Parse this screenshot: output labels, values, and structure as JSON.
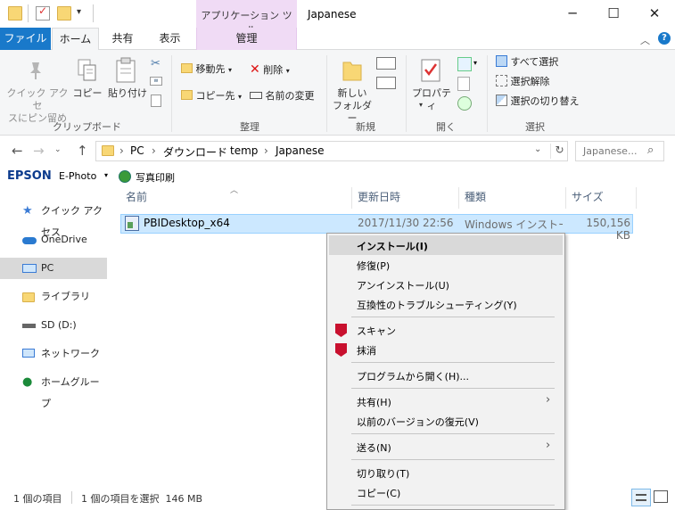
{
  "window": {
    "title": "Japanese",
    "context_tab_title": "アプリケーション ツール",
    "controls": {
      "minimize": "─",
      "maximize": "☐",
      "close": "✕"
    }
  },
  "tabs": [
    {
      "label": "ファイル"
    },
    {
      "label": "ホーム"
    },
    {
      "label": "共有"
    },
    {
      "label": "表示"
    },
    {
      "label": "管理"
    }
  ],
  "ribbon": {
    "clipboard": {
      "pin_label_1": "クイック アクセ",
      "pin_label_2": "スにピン留め",
      "copy_label": "コピー",
      "paste_label": "貼り付け",
      "group": "クリップボード"
    },
    "organize": {
      "move_to": "移動先",
      "copy_to": "コピー先",
      "delete": "削除",
      "rename": "名前の変更",
      "group": "整理"
    },
    "new": {
      "new_folder_1": "新しい",
      "new_folder_2": "フォルダー",
      "group": "新規"
    },
    "open": {
      "properties": "プロパティ",
      "group": "開く"
    },
    "select": {
      "select_all": "すべて選択",
      "select_none": "選択解除",
      "invert": "選択の切り替え",
      "group": "選択"
    }
  },
  "address": {
    "crumbs": [
      "PC",
      "ダウンロード",
      "temp",
      "Japanese"
    ],
    "search_placeholder": "Japanese..."
  },
  "epson": {
    "brand": "EPSON",
    "app": "E-Photo",
    "print": "写真印刷"
  },
  "nav": [
    {
      "label": "クイック アクセス"
    },
    {
      "label": "OneDrive"
    },
    {
      "label": "PC"
    },
    {
      "label": "ライブラリ"
    },
    {
      "label": "SD (D:)"
    },
    {
      "label": "ネットワーク"
    },
    {
      "label": "ホームグループ"
    }
  ],
  "columns": {
    "name": "名前",
    "modified": "更新日時",
    "type": "種類",
    "size": "サイズ"
  },
  "file": {
    "name": "PBIDesktop_x64",
    "modified": "2017/11/30 22:56",
    "type": "Windows インストー...",
    "size": "150,156 KB"
  },
  "context_menu": {
    "install": "インストール(I)",
    "repair": "修復(P)",
    "uninstall": "アンインストール(U)",
    "troubleshoot": "互換性のトラブルシューティング(Y)",
    "scan": "スキャン",
    "erase": "抹消",
    "open_with": "プログラムから開く(H)...",
    "share": "共有(H)",
    "restore": "以前のバージョンの復元(V)",
    "send_to": "送る(N)",
    "cut": "切り取り(T)",
    "copy": "コピー(C)"
  },
  "status": {
    "items": "1 個の項目",
    "selected": "1 個の項目を選択  146 MB"
  },
  "colors": {
    "file_tab": "#1979ca",
    "manage_tab": "#f0dbf5",
    "selection": "#cce8ff",
    "mcafee": "#c8102e"
  }
}
